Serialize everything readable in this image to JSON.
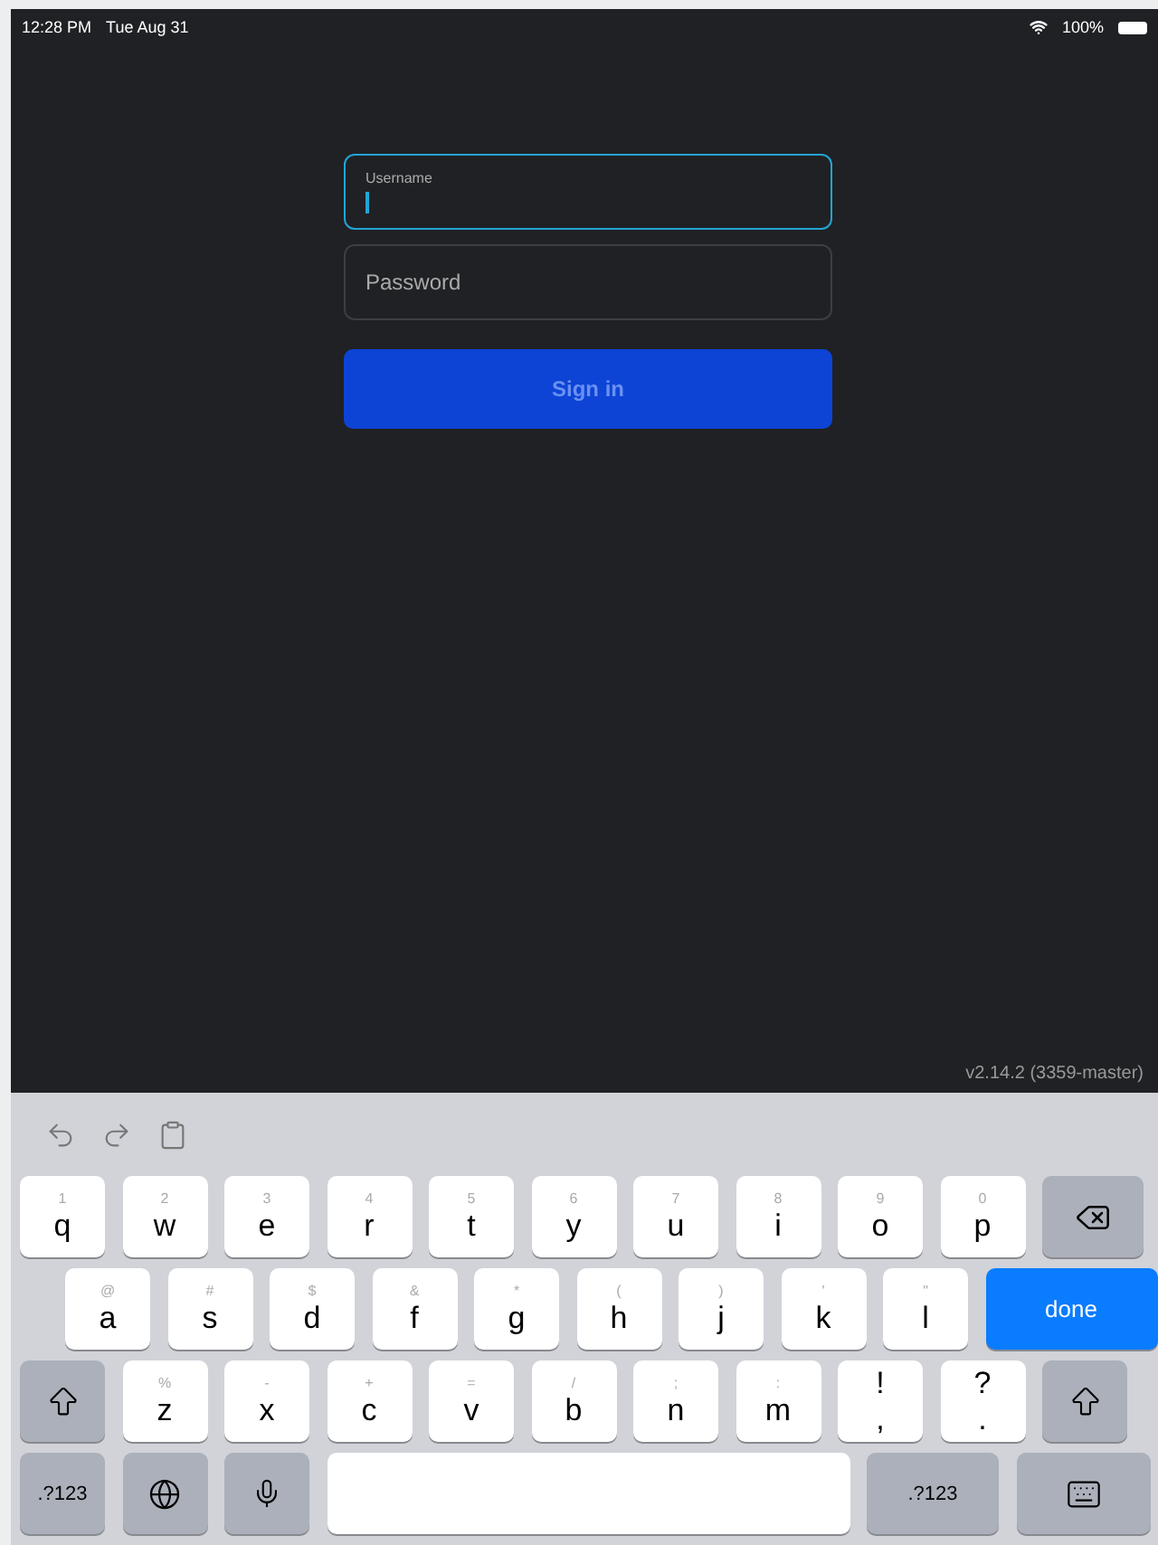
{
  "status_bar": {
    "time": "12:28 PM",
    "date": "Tue Aug 31",
    "battery": "100%"
  },
  "login": {
    "username": {
      "label": "Username",
      "focused": true
    },
    "password": {
      "placeholder": "Password"
    },
    "sign_in": {
      "label": "Sign in",
      "disabled": true
    }
  },
  "version": "v2.14.2 (3359-master)",
  "keyboard": {
    "rows": [
      [
        {
          "kind": "letter",
          "main": "q",
          "alt": "1"
        },
        {
          "kind": "letter",
          "main": "w",
          "alt": "2"
        },
        {
          "kind": "letter",
          "main": "e",
          "alt": "3"
        },
        {
          "kind": "letter",
          "main": "r",
          "alt": "4"
        },
        {
          "kind": "letter",
          "main": "t",
          "alt": "5"
        },
        {
          "kind": "letter",
          "main": "y",
          "alt": "6"
        },
        {
          "kind": "letter",
          "main": "u",
          "alt": "7"
        },
        {
          "kind": "letter",
          "main": "i",
          "alt": "8"
        },
        {
          "kind": "letter",
          "main": "o",
          "alt": "9"
        },
        {
          "kind": "letter",
          "main": "p",
          "alt": "0"
        },
        {
          "kind": "delete"
        }
      ],
      [
        {
          "kind": "letter",
          "main": "a",
          "alt": "@"
        },
        {
          "kind": "letter",
          "main": "s",
          "alt": "#"
        },
        {
          "kind": "letter",
          "main": "d",
          "alt": "$"
        },
        {
          "kind": "letter",
          "main": "f",
          "alt": "&"
        },
        {
          "kind": "letter",
          "main": "g",
          "alt": "*"
        },
        {
          "kind": "letter",
          "main": "h",
          "alt": "("
        },
        {
          "kind": "letter",
          "main": "j",
          "alt": ")"
        },
        {
          "kind": "letter",
          "main": "k",
          "alt": "'"
        },
        {
          "kind": "letter",
          "main": "l",
          "alt": "\""
        },
        {
          "kind": "done",
          "label": "done"
        }
      ],
      [
        {
          "kind": "shift"
        },
        {
          "kind": "letter",
          "main": "z",
          "alt": "%"
        },
        {
          "kind": "letter",
          "main": "x",
          "alt": "-"
        },
        {
          "kind": "letter",
          "main": "c",
          "alt": "+"
        },
        {
          "kind": "letter",
          "main": "v",
          "alt": "="
        },
        {
          "kind": "letter",
          "main": "b",
          "alt": "/"
        },
        {
          "kind": "letter",
          "main": "n",
          "alt": ";"
        },
        {
          "kind": "letter",
          "main": "m",
          "alt": ":"
        },
        {
          "kind": "punct",
          "main": ",",
          "alt": "!"
        },
        {
          "kind": "punct",
          "main": ".",
          "alt": "?"
        },
        {
          "kind": "shift"
        }
      ],
      [
        {
          "kind": "mode",
          "label": ".?123"
        },
        {
          "kind": "globe"
        },
        {
          "kind": "mic"
        },
        {
          "kind": "space"
        },
        {
          "kind": "mode",
          "label": ".?123",
          "wide": true
        },
        {
          "kind": "hide"
        }
      ]
    ]
  }
}
